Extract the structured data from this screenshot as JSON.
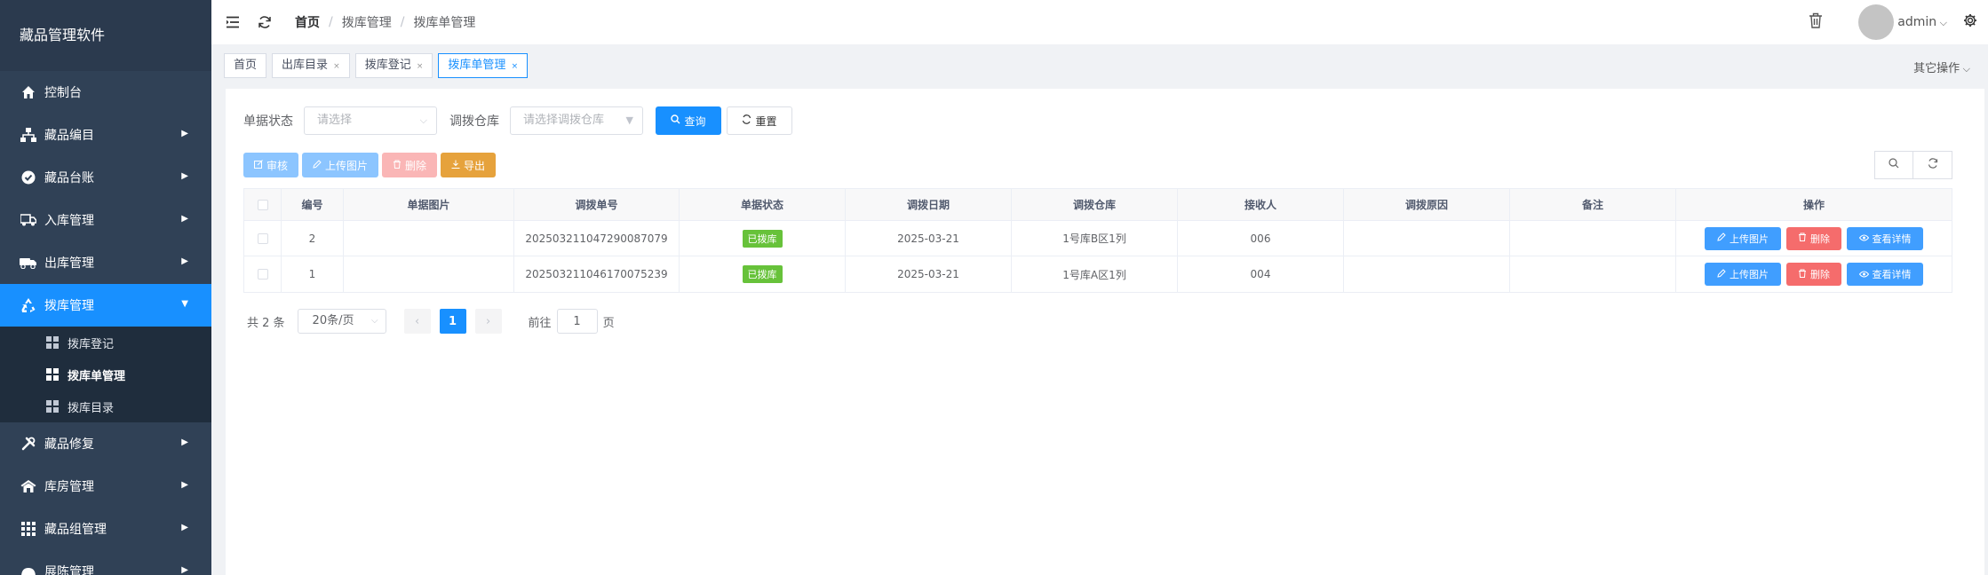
{
  "app": {
    "title": "藏品管理软件"
  },
  "sidebar": {
    "items": [
      {
        "label": "控制台",
        "icon": "home-icon",
        "arrow": false
      },
      {
        "label": "藏品编目",
        "icon": "sitemap-icon",
        "arrow": true
      },
      {
        "label": "藏品台账",
        "icon": "check-circle-icon",
        "arrow": true
      },
      {
        "label": "入库管理",
        "icon": "truck-icon",
        "arrow": true
      },
      {
        "label": "出库管理",
        "icon": "truck-loading-icon",
        "arrow": true
      },
      {
        "label": "拨库管理",
        "icon": "recycle-icon",
        "arrow": true,
        "active": true
      },
      {
        "label": "藏品修复",
        "icon": "tools-icon",
        "arrow": true
      },
      {
        "label": "库房管理",
        "icon": "warehouse-icon",
        "arrow": true
      },
      {
        "label": "藏品组管理",
        "icon": "grid-icon",
        "arrow": true
      },
      {
        "label": "展陈管理",
        "icon": "exhibit-icon",
        "arrow": true
      }
    ],
    "submenu": [
      {
        "label": "拨库登记"
      },
      {
        "label": "拨库单管理",
        "active": true
      },
      {
        "label": "拨库目录"
      }
    ]
  },
  "navbar": {
    "breadcrumb": [
      "首页",
      "拨库管理",
      "拨库单管理"
    ],
    "user": "admin"
  },
  "tags": {
    "items": [
      {
        "label": "首页",
        "closable": false
      },
      {
        "label": "出库目录",
        "closable": true
      },
      {
        "label": "拨库登记",
        "closable": true
      },
      {
        "label": "拨库单管理",
        "closable": true,
        "active": true
      }
    ],
    "other_ops": "其它操作",
    "close_symbol": "×"
  },
  "filters": {
    "status_label": "单据状态",
    "status_placeholder": "请选择",
    "warehouse_label": "调拨仓库",
    "warehouse_placeholder": "请选择调拨仓库",
    "search_btn": "查询",
    "reset_btn": "重置"
  },
  "toolbar": {
    "audit": "审核",
    "upload": "上传图片",
    "delete": "删除",
    "export": "导出"
  },
  "table": {
    "columns": [
      "编号",
      "单据图片",
      "调拨单号",
      "单据状态",
      "调拨日期",
      "调拨仓库",
      "接收人",
      "调拨原因",
      "备注",
      "操作"
    ],
    "rows": [
      {
        "id": "2",
        "image": "",
        "order_no": "202503211047290087079",
        "status": "已拨库",
        "date": "2025-03-21",
        "warehouse": "1号库B区1列",
        "receiver": "006",
        "reason": "",
        "remark": ""
      },
      {
        "id": "1",
        "image": "",
        "order_no": "202503211046170075239",
        "status": "已拨库",
        "date": "2025-03-21",
        "warehouse": "1号库A区1列",
        "receiver": "004",
        "reason": "",
        "remark": ""
      }
    ],
    "actions": {
      "upload": "上传图片",
      "delete": "删除",
      "view": "查看详情"
    }
  },
  "pagination": {
    "total_text": "共 2 条",
    "page_size": "20条/页",
    "current_page": "1",
    "goto_label": "前往",
    "goto_value": "1",
    "page_suffix": "页"
  },
  "colors": {
    "sidebar_bg": "#304156",
    "primary": "#1890ff",
    "success": "#67c23a",
    "danger": "#f56c6c",
    "warning": "#e6a23c"
  }
}
